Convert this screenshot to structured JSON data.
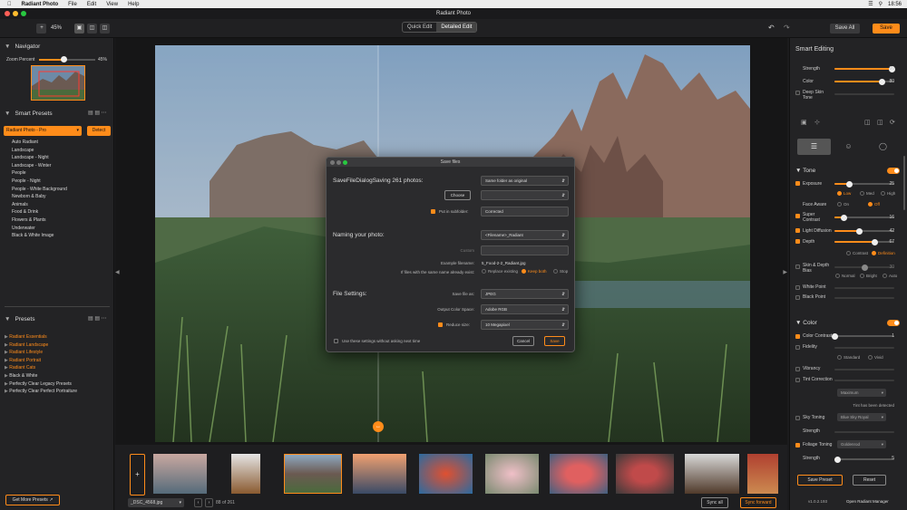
{
  "menubar": {
    "app": "Radiant Photo",
    "items": [
      "File",
      "Edit",
      "View",
      "Help"
    ],
    "clock": "18:56"
  },
  "window": {
    "title": "Radiant Photo"
  },
  "toolbar": {
    "zoom": "45%",
    "quick_edit": "Quick Edit",
    "detailed_edit": "Detailed Edit",
    "save_all": "Save All",
    "save": "Save"
  },
  "navigator": {
    "title": "Navigator",
    "zoom_label": "Zoom Percent",
    "zoom_value": "45%",
    "zoom_fraction": 0.45
  },
  "smart_presets": {
    "title": "Smart Presets",
    "selected": "Radiant Photo - Pro",
    "detect": "Detect",
    "items": [
      "Auto Radiant",
      "Landscape",
      "Landscape - Night",
      "Landscape - Winter",
      "People",
      "People - Night",
      "People - White Background",
      "Newborn & Baby",
      "Animals",
      "Food & Drink",
      "Flowers & Plants",
      "Underwater",
      "Black & White Image"
    ]
  },
  "presets": {
    "title": "Presets",
    "items": [
      {
        "label": "Radiant Essentials",
        "orange": true
      },
      {
        "label": "Radiant Landscape",
        "orange": true
      },
      {
        "label": "Radiant Lifestyle",
        "orange": true
      },
      {
        "label": "Radiant Portrait",
        "orange": true
      },
      {
        "label": "Radiant Cats",
        "orange": true
      },
      {
        "label": "Black & White",
        "orange": false
      },
      {
        "label": "Perfectly Clear Legacy Presets",
        "orange": false
      },
      {
        "label": "Perfectly Clear Perfect Portraiture",
        "orange": false
      }
    ],
    "get_more": "Get More Presets"
  },
  "dialog": {
    "title": "Save files",
    "heading": "SaveFileDialogSaving 261 photos:",
    "folder": "Same folder as original",
    "choose": "Choose",
    "subfolder_label": "Put in subfolder:",
    "subfolder_value": "Corrected",
    "naming_heading": "Naming your photo:",
    "naming_value": "<Filename>_Radiant",
    "custom_label": "Custom",
    "example_label": "Example filename:",
    "example_value": "5_Food-2-2_Radiant.jpg",
    "exists_label": "If files with the same name already exist:",
    "exists_options": [
      "Replace existing",
      "Keep both",
      "Stop"
    ],
    "file_settings_heading": "File Settings:",
    "save_as_label": "Save file as:",
    "save_as_value": "JPEG",
    "color_space_label": "Output Color Space:",
    "color_space_value": "Adobe RGB",
    "reduce_label": "Reduce size:",
    "reduce_value": "10 Megapixel",
    "remember": "Use these settings without asking next time",
    "cancel": "Cancel",
    "save": "Save"
  },
  "smart_editing": {
    "title": "Smart Editing",
    "strength_label": "Strength",
    "strength_value": "96",
    "color_label": "Color",
    "color_value": "80",
    "deep_skin": "Deep Skin Tone"
  },
  "tone": {
    "title": "Tone",
    "exposure_label": "Exposure",
    "exposure_value": "25",
    "exposure_modes": [
      "Low",
      "Med",
      "High"
    ],
    "face_aware": "Face Aware",
    "face_aware_options": [
      "On",
      "Off"
    ],
    "super_contrast": "Super Contrast",
    "super_contrast_value": "16",
    "light_diffusion": "Light Diffusion",
    "light_diffusion_value": "42",
    "depth": "Depth",
    "depth_value": "67",
    "depth_modes": [
      "Contrast",
      "Definition"
    ],
    "skin_depth_bias": "Skin & Depth Bias",
    "skin_depth_value": "30",
    "bias_modes": [
      "Normal",
      "Bright",
      "Auto"
    ],
    "white_point": "White Point",
    "black_point": "Black Point"
  },
  "color": {
    "title": "Color",
    "contrast": "Color Contrast",
    "contrast_value": "1",
    "fidelity": "Fidelity",
    "fidelity_modes": [
      "Standard",
      "Vivid"
    ],
    "vibrancy": "Vibrancy",
    "tint": "Tint Correction",
    "tint_select": "Maximum",
    "tint_note": "Tint has been detected",
    "sky": "Sky Toning",
    "sky_select": "Blue Sky Royal",
    "sky_strength": "Strength",
    "foliage": "Foliage Toning",
    "foliage_select": "Goldenrod",
    "foliage_strength": "Strength",
    "foliage_value": "5"
  },
  "right_footer": {
    "save_preset": "Save Preset",
    "reset": "Reset",
    "version": "v1.0.2.193",
    "manager": "Open Radiant Manager"
  },
  "status": {
    "filename": "_DSC_4568.jpg",
    "count": "88 of 261",
    "sync_all": "Sync all",
    "sync_forward": "Sync forward"
  },
  "colors": {
    "accent": "#ff8c1a",
    "panel": "#232325"
  }
}
